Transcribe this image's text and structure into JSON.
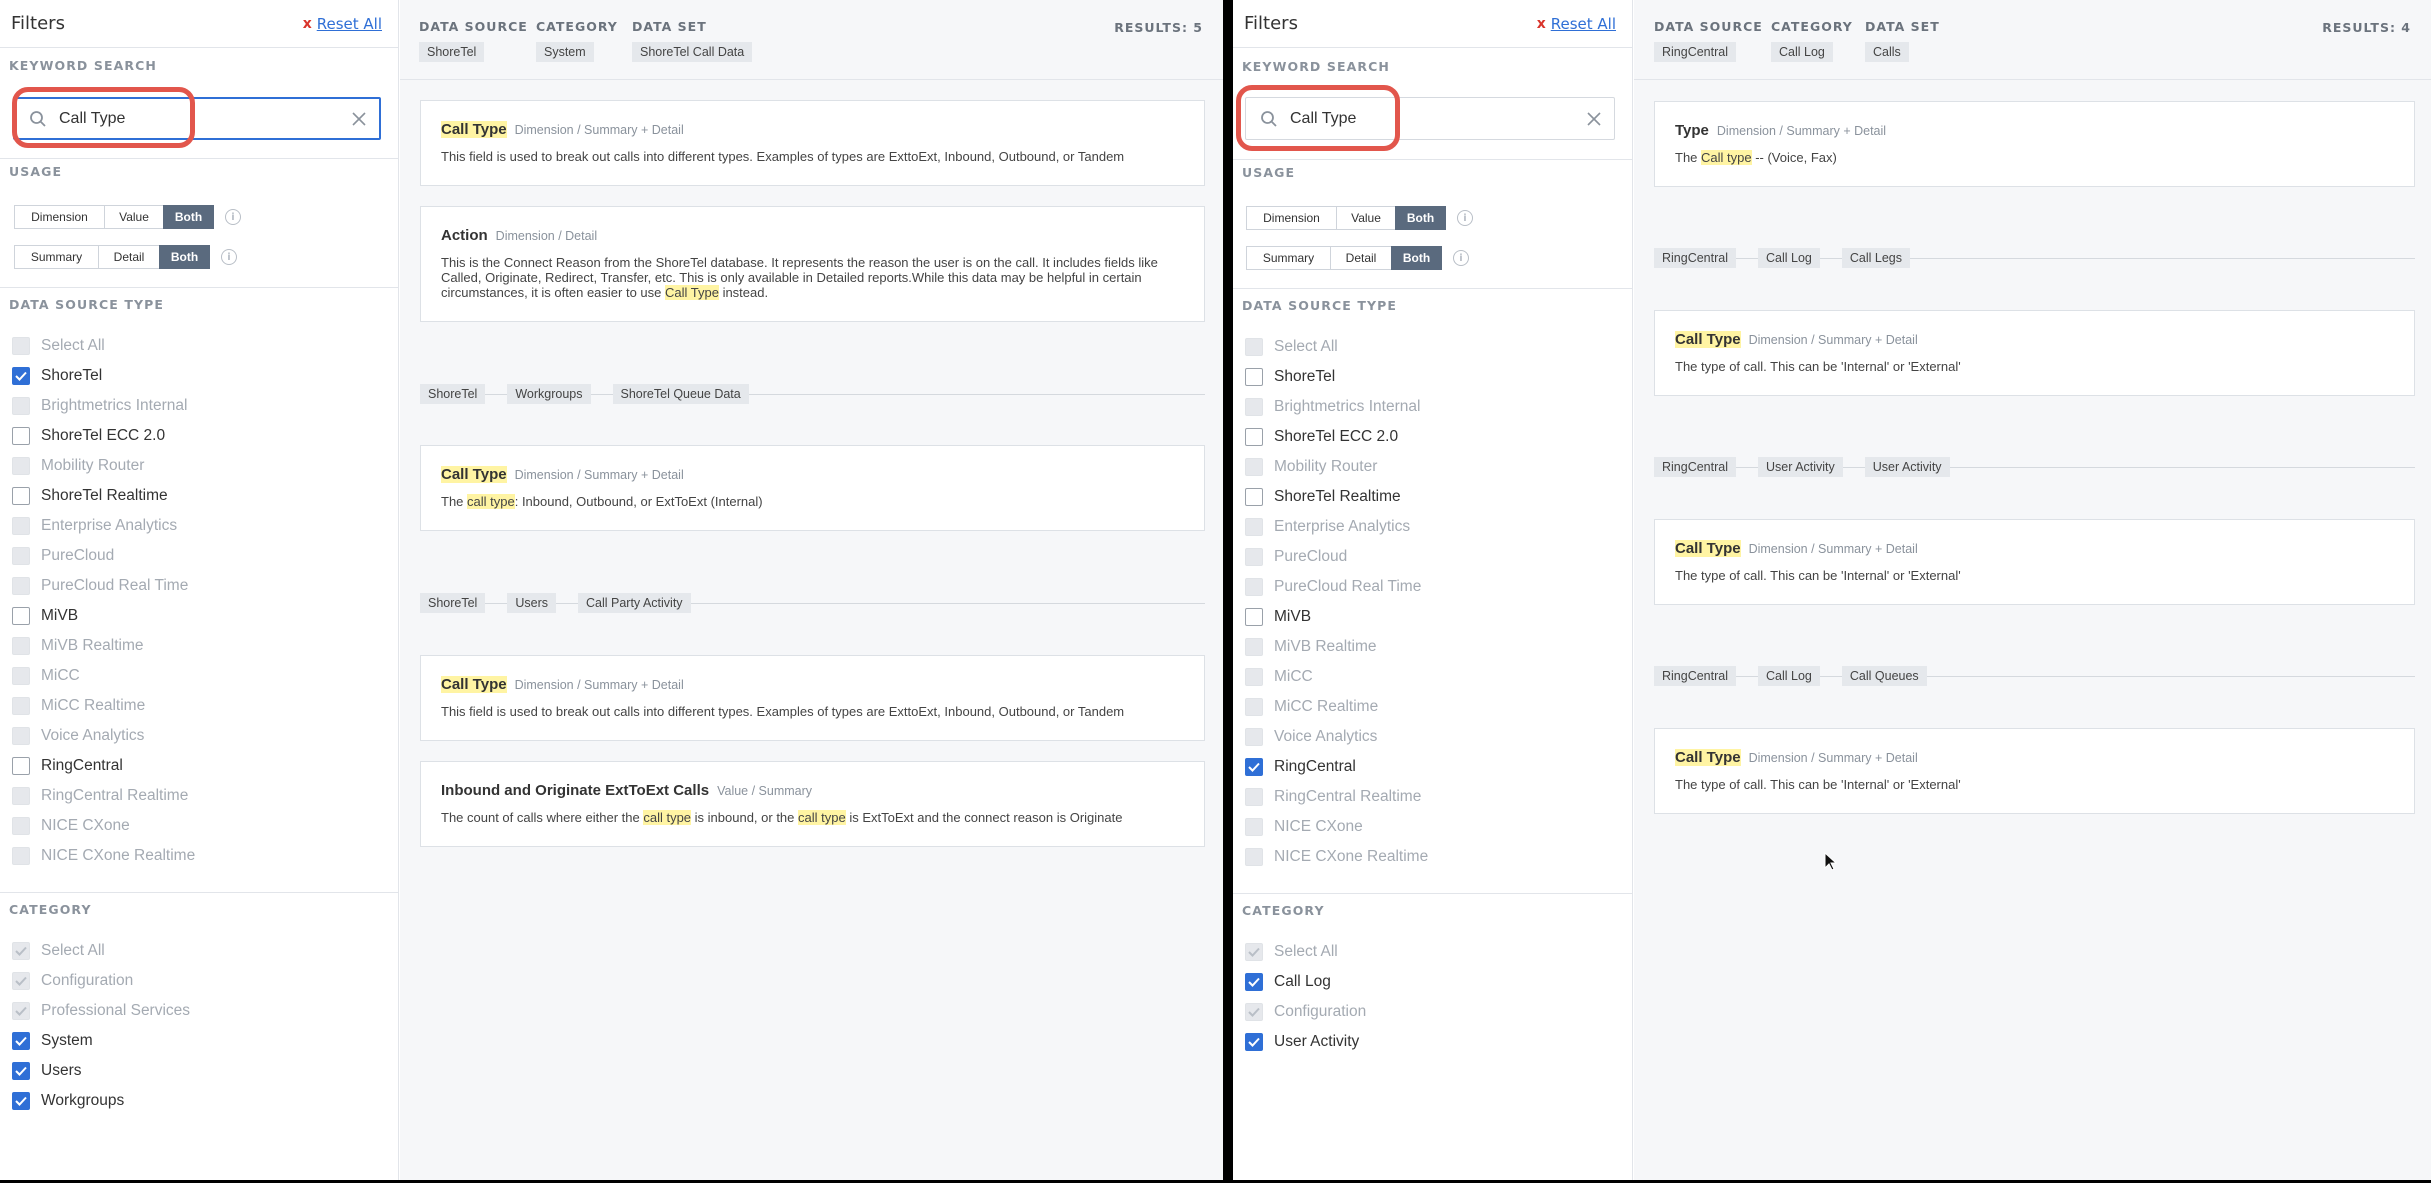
{
  "left": {
    "sidebar": {
      "title": "Filters",
      "reset_x": "x",
      "reset_label": "Reset All",
      "keyword_label": "KEYWORD SEARCH",
      "search_value": "Call Type",
      "usage_label": "USAGE",
      "usage_row1": [
        "Dimension",
        "Value",
        "Both"
      ],
      "usage_row2": [
        "Summary",
        "Detail",
        "Both"
      ],
      "ds_label": "DATA SOURCE TYPE",
      "ds_items": [
        {
          "label": "Select All",
          "state": "disabled"
        },
        {
          "label": "ShoreTel",
          "state": "checked"
        },
        {
          "label": "Brightmetrics Internal",
          "state": "disabled"
        },
        {
          "label": "ShoreTel ECC 2.0",
          "state": "unchecked"
        },
        {
          "label": "Mobility Router",
          "state": "disabled"
        },
        {
          "label": "ShoreTel Realtime",
          "state": "unchecked"
        },
        {
          "label": "Enterprise Analytics",
          "state": "disabled"
        },
        {
          "label": "PureCloud",
          "state": "disabled"
        },
        {
          "label": "PureCloud Real Time",
          "state": "disabled"
        },
        {
          "label": "MiVB",
          "state": "unchecked"
        },
        {
          "label": "MiVB Realtime",
          "state": "disabled"
        },
        {
          "label": "MiCC",
          "state": "disabled"
        },
        {
          "label": "MiCC Realtime",
          "state": "disabled"
        },
        {
          "label": "Voice Analytics",
          "state": "disabled"
        },
        {
          "label": "RingCentral",
          "state": "unchecked"
        },
        {
          "label": "RingCentral Realtime",
          "state": "disabled"
        },
        {
          "label": "NICE CXone",
          "state": "disabled"
        },
        {
          "label": "NICE CXone Realtime",
          "state": "disabled"
        }
      ],
      "cat_label": "CATEGORY",
      "cat_items": [
        {
          "label": "Select All",
          "state": "disabled-checked"
        },
        {
          "label": "Configuration",
          "state": "disabled-checked"
        },
        {
          "label": "Professional Services",
          "state": "disabled-checked"
        },
        {
          "label": "System",
          "state": "checked"
        },
        {
          "label": "Users",
          "state": "checked"
        },
        {
          "label": "Workgroups",
          "state": "checked"
        }
      ]
    },
    "header": {
      "ds_label": "DATA SOURCE",
      "ds_value": "ShoreTel",
      "cat_label": "CATEGORY",
      "cat_value": "System",
      "set_label": "DATA SET",
      "set_value": "ShoreTel Call Data",
      "results": "RESULTS: 5"
    },
    "cards": [
      {
        "title": "Call Type",
        "type": "Dimension / Summary + Detail",
        "desc": "This field is used to break out calls into different types. Examples of types are ExttoExt, Inbound, Outbound, or Tandem"
      },
      {
        "title": "Action",
        "type": "Dimension / Detail",
        "desc_a": "This is the Connect Reason from the ShoreTel database. It represents the reason the user is on the call. It includes fields like Called, Originate, Redirect, Transfer, etc. This is only available in Detailed reports.While this data may be helpful in certain circumstances, it is often easier to use ",
        "desc_hl": "Call Type",
        "desc_b": " instead."
      },
      {
        "title": "Call Type",
        "type": "Dimension / Summary + Detail",
        "desc_a": "The ",
        "desc_hl": "call type",
        "desc_b": ": Inbound, Outbound, or ExtToExt (Internal)"
      },
      {
        "title": "Call Type",
        "type": "Dimension / Summary + Detail",
        "desc": "This field is used to break out calls into different types. Examples of types are ExttoExt, Inbound, Outbound, or Tandem"
      },
      {
        "title": "Inbound and Originate ExtToExt Calls",
        "type": "Value / Summary",
        "desc_a": "The count of calls where either the ",
        "desc_hl": "call type",
        "desc_b": " is inbound, or the ",
        "desc_hl2": "call type",
        "desc_c": " is ExtToExt and the connect reason is Originate"
      }
    ],
    "paths": [
      [
        "ShoreTel",
        "Workgroups",
        "ShoreTel Queue Data"
      ],
      [
        "ShoreTel",
        "Users",
        "Call Party Activity"
      ]
    ]
  },
  "right": {
    "sidebar": {
      "title": "Filters",
      "reset_x": "x",
      "reset_label": "Reset All",
      "keyword_label": "KEYWORD SEARCH",
      "search_value": "Call Type",
      "usage_label": "USAGE",
      "usage_row1": [
        "Dimension",
        "Value",
        "Both"
      ],
      "usage_row2": [
        "Summary",
        "Detail",
        "Both"
      ],
      "ds_label": "DATA SOURCE TYPE",
      "ds_items": [
        {
          "label": "Select All",
          "state": "disabled"
        },
        {
          "label": "ShoreTel",
          "state": "unchecked"
        },
        {
          "label": "Brightmetrics Internal",
          "state": "disabled"
        },
        {
          "label": "ShoreTel ECC 2.0",
          "state": "unchecked"
        },
        {
          "label": "Mobility Router",
          "state": "disabled"
        },
        {
          "label": "ShoreTel Realtime",
          "state": "unchecked"
        },
        {
          "label": "Enterprise Analytics",
          "state": "disabled"
        },
        {
          "label": "PureCloud",
          "state": "disabled"
        },
        {
          "label": "PureCloud Real Time",
          "state": "disabled"
        },
        {
          "label": "MiVB",
          "state": "unchecked"
        },
        {
          "label": "MiVB Realtime",
          "state": "disabled"
        },
        {
          "label": "MiCC",
          "state": "disabled"
        },
        {
          "label": "MiCC Realtime",
          "state": "disabled"
        },
        {
          "label": "Voice Analytics",
          "state": "disabled"
        },
        {
          "label": "RingCentral",
          "state": "checked"
        },
        {
          "label": "RingCentral Realtime",
          "state": "disabled"
        },
        {
          "label": "NICE CXone",
          "state": "disabled"
        },
        {
          "label": "NICE CXone Realtime",
          "state": "disabled"
        }
      ],
      "cat_label": "CATEGORY",
      "cat_items": [
        {
          "label": "Select All",
          "state": "disabled-checked"
        },
        {
          "label": "Call Log",
          "state": "checked"
        },
        {
          "label": "Configuration",
          "state": "disabled-checked"
        },
        {
          "label": "User Activity",
          "state": "checked"
        }
      ]
    },
    "header": {
      "ds_label": "DATA SOURCE",
      "ds_value": "RingCentral",
      "cat_label": "CATEGORY",
      "cat_value": "Call Log",
      "set_label": "DATA SET",
      "set_value": "Calls",
      "results": "RESULTS: 4"
    },
    "cards": [
      {
        "title": "Type",
        "type": "Dimension / Summary + Detail",
        "desc_a": "The ",
        "desc_hl": "Call type",
        "desc_b": " -- (Voice, Fax)"
      },
      {
        "title": "Call Type",
        "type": "Dimension / Summary + Detail",
        "desc": "The type of call. This can be 'Internal' or 'External'"
      },
      {
        "title": "Call Type",
        "type": "Dimension / Summary + Detail",
        "desc": "The type of call. This can be 'Internal' or 'External'"
      },
      {
        "title": "Call Type",
        "type": "Dimension / Summary + Detail",
        "desc": "The type of call. This can be 'Internal' or 'External'"
      }
    ],
    "paths": [
      [
        "RingCentral",
        "Call Log",
        "Call Legs"
      ],
      [
        "RingCentral",
        "User Activity",
        "User Activity"
      ],
      [
        "RingCentral",
        "Call Log",
        "Call Queues"
      ]
    ]
  },
  "colors": {
    "accent": "#2f6fd6",
    "highlight": "#fff4a3",
    "ring": "#e2564c",
    "segment_active": "#5a6a7e"
  }
}
